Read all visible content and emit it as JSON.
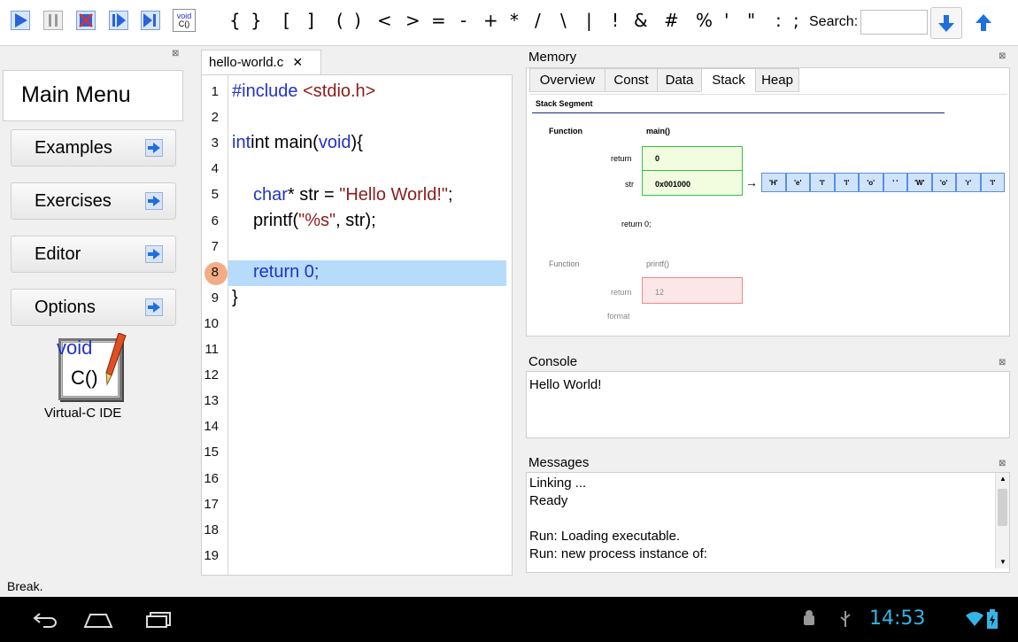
{
  "toolbar": {
    "symbols": [
      "{",
      "}",
      "[",
      "]",
      "(",
      ")",
      "<",
      ">",
      "=",
      "-",
      "+",
      "*",
      "/",
      "\\",
      "|",
      "!",
      "&",
      "#",
      "%",
      "'",
      "\"",
      ":",
      ";"
    ],
    "search_label": "Search:",
    "search_value": "",
    "void_icon_text": [
      "void",
      "C()"
    ]
  },
  "left_panel": {
    "title": "Main Menu",
    "items": [
      {
        "label": "Examples"
      },
      {
        "label": "Exercises"
      },
      {
        "label": "Editor"
      },
      {
        "label": "Options"
      }
    ],
    "logo_text": [
      "void",
      "C()"
    ],
    "logo_label": "Virtual-C IDE"
  },
  "editor": {
    "tab_label": "hello-world.c",
    "tab_close": "✕",
    "line_numbers": [
      "1",
      "2",
      "3",
      "4",
      "5",
      "6",
      "7",
      "8",
      "9",
      "10",
      "11",
      "12",
      "13",
      "14",
      "15",
      "16",
      "17",
      "18",
      "19"
    ],
    "current_line": "8",
    "code": {
      "l1_kw": "#include",
      "l1_hdr": "<stdio.h>",
      "l3_a": "int main(",
      "l3_kw": "void",
      "l3_b": "){",
      "l5_kw": "char",
      "l5_a": "* str = ",
      "l5_str": "\"Hello World!\"",
      "l5_b": ";",
      "l6_a": "printf(",
      "l6_str": "\"%s\"",
      "l6_b": ", str);",
      "l8": "return 0;",
      "l9": "}"
    }
  },
  "memory": {
    "title": "Memory",
    "tabs": [
      "Overview",
      "Const",
      "Data",
      "Stack",
      "Heap"
    ],
    "active_tab": "Stack",
    "stack": {
      "segment_title": "Stack Segment",
      "frame1": {
        "function_label": "Function",
        "function_name": "main()",
        "return_label": "return",
        "return_value": "0",
        "str_label": "str",
        "str_value": "0x001000",
        "return_stmt": "return 0;",
        "chars": [
          "'H'",
          "'e'",
          "'l'",
          "'l'",
          "'o'",
          "' '",
          "'W'",
          "'o'",
          "'r'",
          "'l'"
        ]
      },
      "frame2": {
        "function_label": "Function",
        "function_name": "printf()",
        "return_label": "return",
        "return_value": "12",
        "format_label": "format"
      }
    }
  },
  "console": {
    "title": "Console",
    "output": "Hello World!"
  },
  "messages": {
    "title": "Messages",
    "lines": [
      "Linking ...",
      "Ready",
      "",
      "Run: Loading executable.",
      "Run: new process instance of:"
    ]
  },
  "status": {
    "text": "Break."
  },
  "system_bar": {
    "time": "14:53"
  },
  "colors": {
    "keyword": "#2132c8",
    "string": "#8c1c1c",
    "highlight": "#b6dbfb",
    "breakpoint": "#f3ad86",
    "toolbar_blue": "#1e6fe0"
  }
}
